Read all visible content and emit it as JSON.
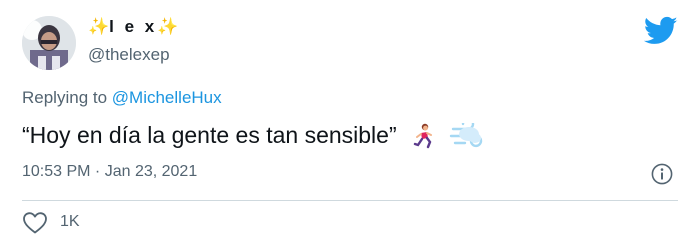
{
  "user": {
    "display_name_sparkle_left": "✨",
    "display_name_text": "l e x",
    "display_name_sparkle_right": "✨",
    "handle": "@thelexep"
  },
  "reply": {
    "prefix": "Replying to ",
    "mention": "@MichelleHux"
  },
  "tweet": {
    "text": "“Hoy en día la gente es tan sensible”",
    "emojis": [
      "woman-running-emoji",
      "dash-emoji"
    ],
    "timestamp": "10:53 PM · Jan 23, 2021"
  },
  "actions": {
    "like_count": "1K"
  },
  "colors": {
    "brand": "#1d9bf0",
    "secondary_text": "#536471",
    "mention": "#1b95e0",
    "divider": "#cfd9de"
  }
}
